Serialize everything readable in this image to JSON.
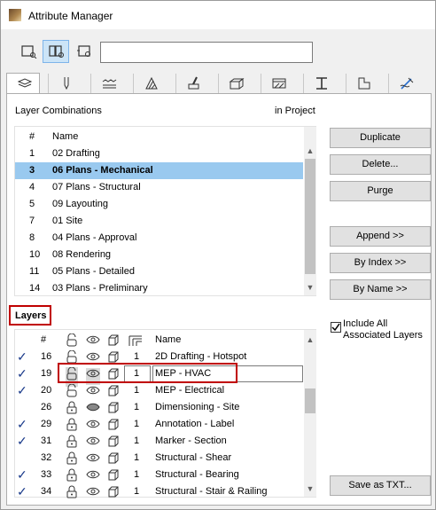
{
  "window": {
    "title": "Attribute Manager",
    "search": {
      "value": "",
      "placeholder": ""
    }
  },
  "toolbar": {
    "icons": [
      "single-list-view-icon",
      "dual-list-view-icon",
      "open-file-view-icon"
    ]
  },
  "tabs": [
    {
      "icon": "layers-tab-icon",
      "active": true
    },
    {
      "icon": "pens-tab-icon"
    },
    {
      "icon": "line-types-tab-icon"
    },
    {
      "icon": "fill-types-tab-icon"
    },
    {
      "icon": "surfaces-tab-icon"
    },
    {
      "icon": "building-materials-tab-icon"
    },
    {
      "icon": "composites-tab-icon"
    },
    {
      "icon": "profiles-tab-icon"
    },
    {
      "icon": "zone-categories-tab-icon"
    },
    {
      "icon": "mep-systems-tab-icon"
    }
  ],
  "layer_combinations": {
    "title": "Layer Combinations",
    "location": "in Project",
    "columns": [
      "#",
      "Name"
    ],
    "rows": [
      {
        "num": "1",
        "name": "02 Drafting"
      },
      {
        "num": "3",
        "name": "06 Plans - Mechanical",
        "selected": true
      },
      {
        "num": "4",
        "name": "07 Plans - Structural"
      },
      {
        "num": "5",
        "name": "09 Layouting"
      },
      {
        "num": "7",
        "name": "01 Site"
      },
      {
        "num": "8",
        "name": "04 Plans - Approval"
      },
      {
        "num": "10",
        "name": "08 Rendering"
      },
      {
        "num": "11",
        "name": "05 Plans - Detailed"
      },
      {
        "num": "14",
        "name": "03 Plans - Preliminary"
      }
    ]
  },
  "buttons": {
    "duplicate": "Duplicate",
    "delete": "Delete...",
    "purge": "Purge",
    "append": "Append >>",
    "by_index": "By Index >>",
    "by_name": "By Name >>",
    "save_as_txt": "Save as TXT..."
  },
  "include_all": {
    "label_line1": "Include All",
    "label_line2": "Associated Layers",
    "checked": true
  },
  "layers": {
    "title": "Layers",
    "columns": [
      "#",
      "lock-column-icon",
      "eye-column-icon",
      "wireframe-column-icon",
      "intersection-group-column-icon",
      "Name"
    ],
    "rows": [
      {
        "check": "✓",
        "num": "16",
        "lock": "open",
        "vis": "eye",
        "group": "1",
        "name": "2D Drafting - Hotspot"
      },
      {
        "check": "✓",
        "num": "19",
        "lock": "open",
        "vis": "eye",
        "group": "1",
        "name": "MEP - HVAC",
        "editing": true
      },
      {
        "check": "✓",
        "num": "20",
        "lock": "open",
        "vis": "eye",
        "group": "1",
        "name": "MEP - Electrical"
      },
      {
        "check": "",
        "num": "26",
        "lock": "closed",
        "vis": "hidden",
        "group": "1",
        "name": "Dimensioning - Site"
      },
      {
        "check": "✓",
        "num": "29",
        "lock": "closed",
        "vis": "eye",
        "group": "1",
        "name": "Annotation - Label"
      },
      {
        "check": "✓",
        "num": "31",
        "lock": "closed",
        "vis": "eye",
        "group": "1",
        "name": "Marker - Section"
      },
      {
        "check": "",
        "num": "32",
        "lock": "closed",
        "vis": "eye",
        "group": "1",
        "name": "Structural - Shear"
      },
      {
        "check": "✓",
        "num": "33",
        "lock": "closed",
        "vis": "eye",
        "group": "1",
        "name": "Structural - Bearing"
      },
      {
        "check": "✓",
        "num": "34",
        "lock": "closed",
        "vis": "eye",
        "group": "1",
        "name": "Structural - Stair & Railing"
      }
    ]
  },
  "colors": {
    "selection": "#99c9ef",
    "highlight": "#c00000",
    "check": "#1a3a8a"
  }
}
